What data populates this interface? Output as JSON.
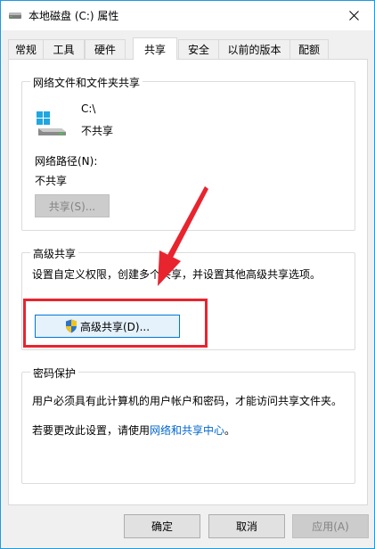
{
  "window": {
    "title": "本地磁盘 (C:) 属性"
  },
  "tabs": [
    {
      "label": "常规"
    },
    {
      "label": "工具"
    },
    {
      "label": "硬件"
    },
    {
      "label": "共享"
    },
    {
      "label": "安全"
    },
    {
      "label": "以前的版本"
    },
    {
      "label": "配额"
    }
  ],
  "network_sharing": {
    "title": "网络文件和文件夹共享",
    "drive_name": "C:\\",
    "drive_status": "不共享",
    "path_label": "网络路径(N):",
    "path_value": "不共享",
    "share_button": "共享(S)..."
  },
  "advanced_sharing": {
    "title": "高级共享",
    "description": "设置自定义权限，创建多个共享，并设置其他高级共享选项。",
    "button": "高级共享(D)..."
  },
  "password_protection": {
    "title": "密码保护",
    "description": "用户必须具有此计算机的用户帐户和密码，才能访问共享文件夹。",
    "change_prefix": "若要更改此设置，请使用",
    "change_link": "网络和共享中心",
    "change_suffix": "。"
  },
  "footer": {
    "ok": "确定",
    "cancel": "取消",
    "apply": "应用(A)"
  },
  "colors": {
    "annotation": "#e8242f",
    "link": "#0066cc"
  }
}
